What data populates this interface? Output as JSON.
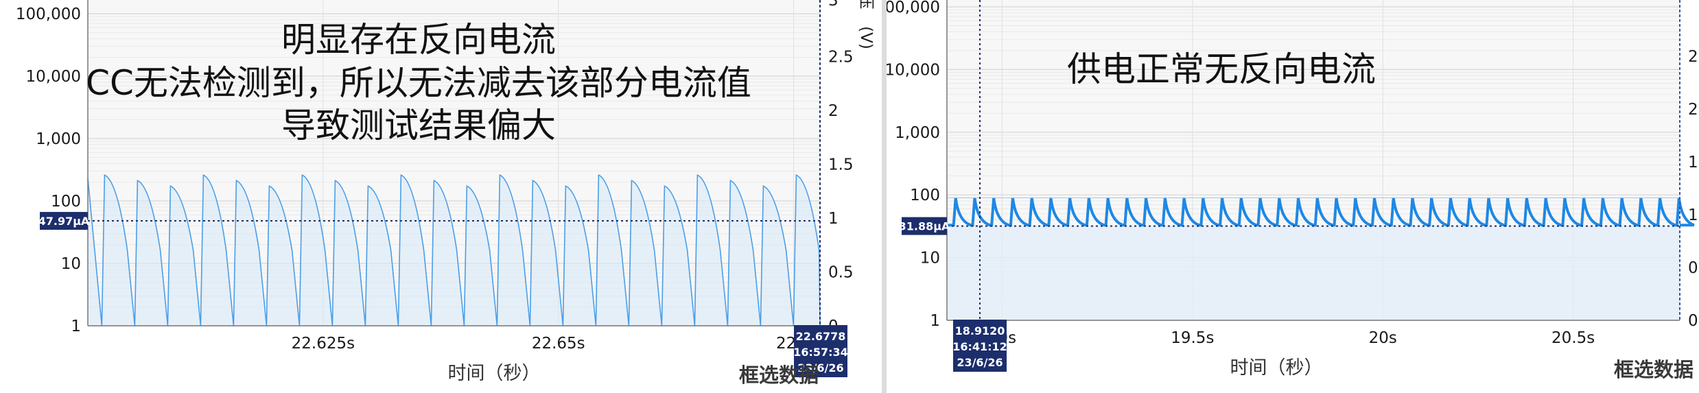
{
  "chart_data": [
    {
      "type": "line",
      "title": "",
      "annotation_lines": [
        "明显存在反向电流",
        "CC无法检测到，所以无法减去该部分电流值",
        "导致测试结果偏大"
      ],
      "xlabel": "时间（秒）",
      "ylabel": "",
      "y_scale": "log",
      "ylim": [
        1,
        100000
      ],
      "y_ticks": [
        "1",
        "10",
        "100",
        "1,000",
        "10,000",
        "100,000"
      ],
      "xlim": [
        22.6,
        22.6778
      ],
      "x_ticks": [
        {
          "value": 22.625,
          "label": "22.625s"
        },
        {
          "value": 22.65,
          "label": "22.65s"
        },
        {
          "value": 22.675,
          "label": "22.6"
        }
      ],
      "y2_label": "(V)",
      "y2_top_partial": "3",
      "y2_top_partial_2": "压",
      "y2_ticks": [
        "0",
        "0.5",
        "1",
        "1.5",
        "2",
        "2.5"
      ],
      "marker_value_label": "47.97µA",
      "marker_value": 47.97,
      "cursor_readout": [
        "22.6778",
        "16:57:34",
        "23/6/26"
      ],
      "series": [
        {
          "pattern": "periodic pulses",
          "period_s": 0.0035,
          "peak_uA": 260,
          "baseline_uA": 1,
          "color": "#4a9ee8"
        }
      ],
      "button_label": "框选数据"
    },
    {
      "type": "line",
      "title": "",
      "annotation_lines": [
        "供电正常无反向电流"
      ],
      "xlabel": "时间（秒）",
      "ylabel": "",
      "y_scale": "log",
      "ylim": [
        1,
        100000
      ],
      "y_ticks": [
        "1",
        "10",
        "100",
        "1,000",
        "10,000",
        "100,000"
      ],
      "xlim": [
        18.855,
        20.78
      ],
      "x_ticks": [
        {
          "value": 19.0,
          "label": "19s"
        },
        {
          "value": 19.5,
          "label": "19.5s"
        },
        {
          "value": 20.0,
          "label": "20s"
        },
        {
          "value": 20.5,
          "label": "20.5s"
        }
      ],
      "y2_ticks": [
        "0",
        "0.5",
        "1",
        "1.5",
        "2",
        "2.5"
      ],
      "y2_tick_labels_visible": [
        "0",
        "0.",
        "1",
        "1.",
        "2",
        "2."
      ],
      "marker_value_label": "31.88µA",
      "marker_value": 31.88,
      "cursor_readout": [
        "18.9120",
        "16:41:12",
        "23/6/26"
      ],
      "series": [
        {
          "pattern": "periodic spikes",
          "period_s": 0.05,
          "peak_uA": 90,
          "baseline_uA": 33,
          "color": "#1e88e5"
        }
      ],
      "button_label": "框选数据"
    }
  ]
}
